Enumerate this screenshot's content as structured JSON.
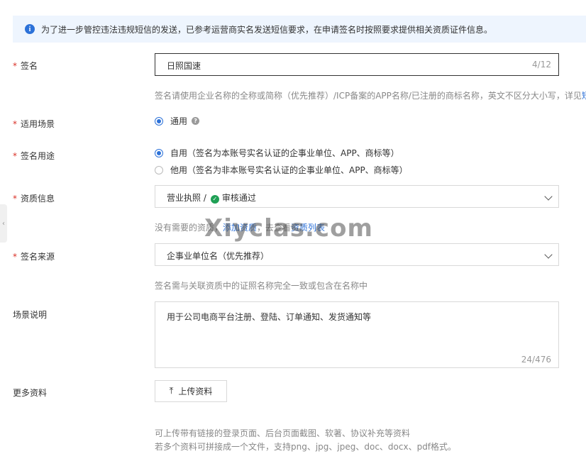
{
  "notice": {
    "icon": "info-icon",
    "text": "为了进一步管控违法违规短信的发送，已参考运营商实名发送短信要求，在申请签名时按照要求提供相关资质证件信息。"
  },
  "required_mark": "*",
  "signature": {
    "label": "签名",
    "value": "日照国速",
    "counter": "4/12",
    "help": "签名请使用企业名称的全称或简称（优先推荐）/ICP备案的APP名称/已注册的商标名称，英文不区分大小写，详见",
    "help_link": "短"
  },
  "scene": {
    "label": "适用场景",
    "option": "通用",
    "help_icon": "?"
  },
  "usage": {
    "label": "签名用途",
    "options": [
      "自用（签名为本账号实名认证的企事业单位、APP、商标等）",
      "他用（签名为非本账号实名认证的企事业单位、APP、商标等）"
    ]
  },
  "qualification": {
    "label": "资质信息",
    "value_prefix": "营业执照 /",
    "status": "审核通过",
    "help_a": "没有需要的资质，",
    "help_link1": "添加资质",
    "help_b": "，去查看",
    "help_link2": "资质列表"
  },
  "source": {
    "label": "签名来源",
    "value": "企事业单位名（优先推荐）",
    "help": "签名需与关联资质中的证照名称完全一致或包含在名称中"
  },
  "scene_desc": {
    "label": "场景说明",
    "value": "用于公司电商平台注册、登陆、订单通知、发货通知等",
    "counter": "24/476"
  },
  "more": {
    "label": "更多资料",
    "button": "上传资料",
    "help_line1": "可上传带有链接的登录页面、后台页面截图、软著、协议补充等资料",
    "help_line2": "若多个资料可拼接成一个文件，支持png、jpg、jpeg、doc、docx、pdf格式。"
  },
  "watermark": "Xiyclas.com",
  "accent_color": "#2c71d8",
  "success_color": "#1fa055",
  "required_color": "#d93026"
}
